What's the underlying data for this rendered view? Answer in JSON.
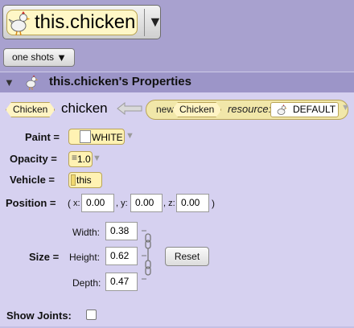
{
  "selector": {
    "title": "this.chicken",
    "icon": "chicken-icon",
    "dropdown_icon": "triangle-down-icon"
  },
  "toolbar": {
    "one_shots_label": "one shots",
    "one_shots_icon": "triangle-down-icon"
  },
  "properties_header": {
    "title": "this.chicken's Properties",
    "icon": "chicken-icon"
  },
  "declaration": {
    "type_label": "Chicken",
    "var_name": "chicken",
    "new_label": "new",
    "new_type": "Chicken",
    "resource_label": "resource:",
    "resource_value": "DEFAULT",
    "resource_icon": "chicken-icon"
  },
  "paint": {
    "label": "Paint =",
    "value": "WHITE",
    "swatch_color": "#ffffff"
  },
  "opacity": {
    "label": "Opacity =",
    "value": "1.0"
  },
  "vehicle": {
    "label": "Vehicle =",
    "value": "this"
  },
  "position": {
    "label": "Position =",
    "open": "(",
    "x_label": "x:",
    "x_value": "0.00",
    "y_label": ", y:",
    "y_value": "0.00",
    "z_label": ", z:",
    "z_value": "0.00",
    "close": ")"
  },
  "size": {
    "label": "Size =",
    "width_label": "Width:",
    "width_value": "0.38",
    "height_label": "Height:",
    "height_value": "0.62",
    "depth_label": "Depth:",
    "depth_value": "0.47",
    "reset_label": "Reset"
  },
  "show_joints": {
    "label": "Show Joints:",
    "checked": false
  },
  "colors": {
    "background": "#a8a1cf",
    "panel": "#d6d1f0",
    "header": "#9c95c8",
    "tile": "#fff4c4"
  }
}
